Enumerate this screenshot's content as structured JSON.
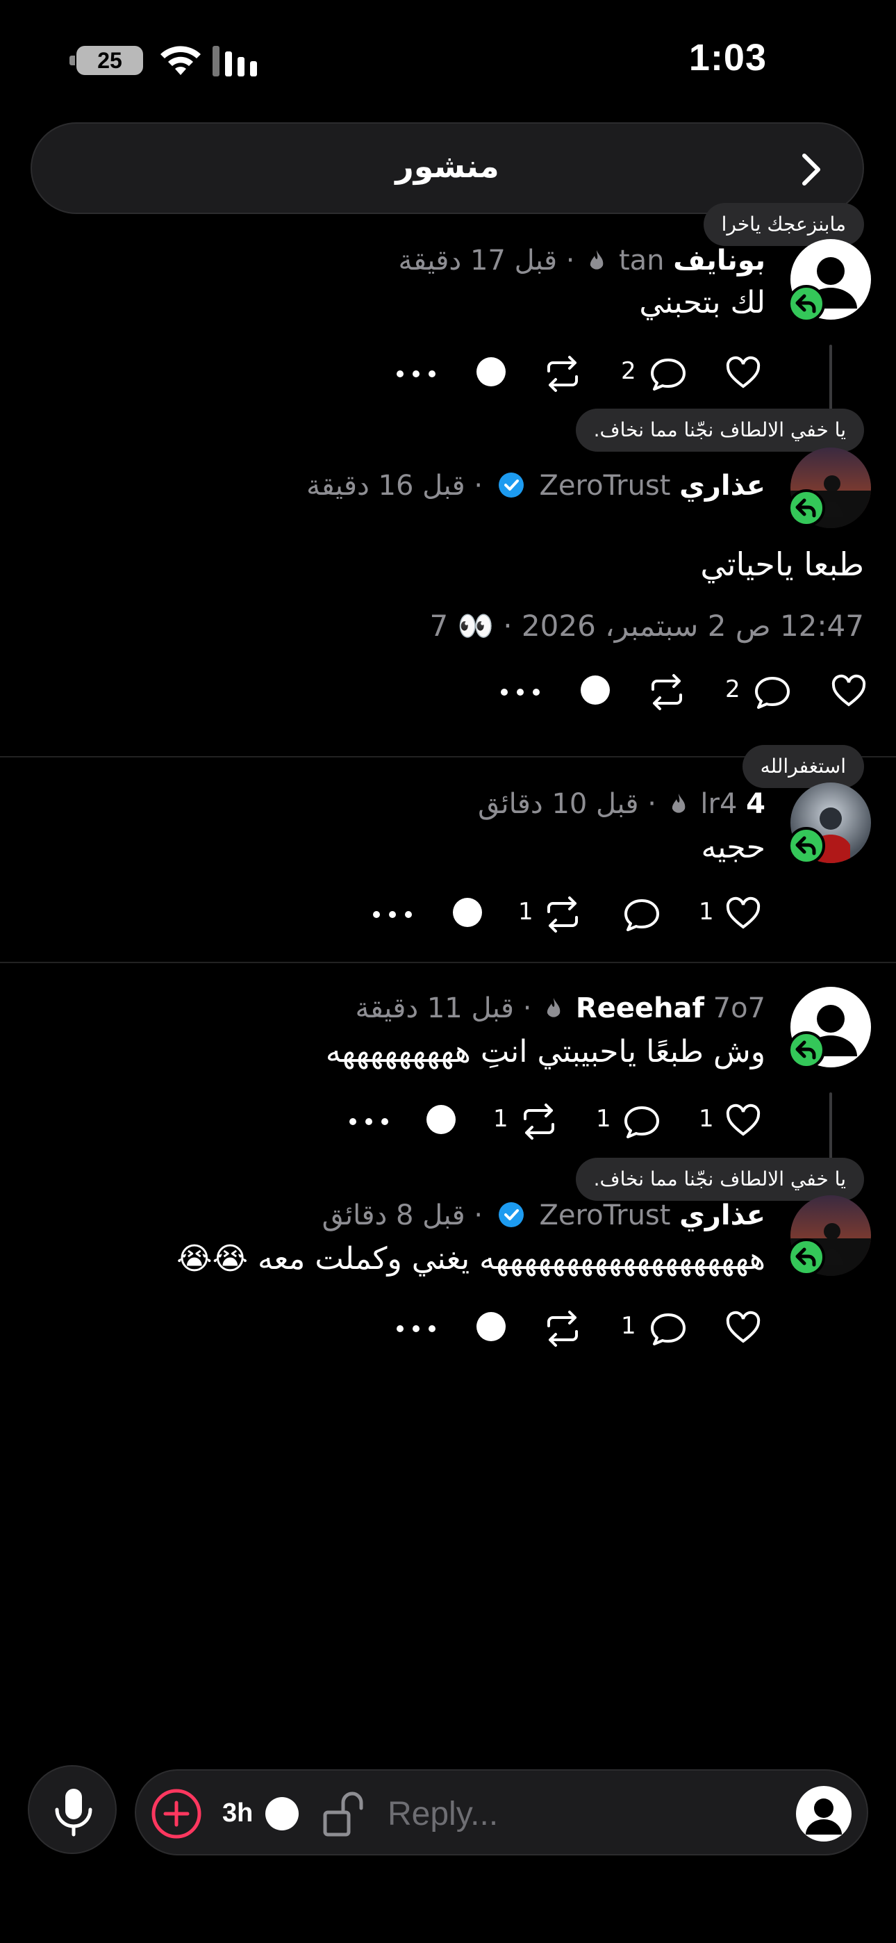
{
  "status_bar": {
    "time": "1:03",
    "battery": "25"
  },
  "header": {
    "title": "منشور"
  },
  "comments": [
    {
      "note": "مابنزعجك ياخرا",
      "name": "بونايف",
      "handle": "tan",
      "time_ago": "قبل 17 دقيقة",
      "text": "لك بتحبني",
      "reply_count": "2"
    },
    {
      "note": "يا خفي الالطاف نجّنا مما نخاف.",
      "name": "عذاري",
      "handle": "ZeroTrust",
      "time_ago": "قبل 16 دقيقة",
      "text": "طبعا ياحياتي",
      "date": "12:47 ص 2 سبتمبر، 2026",
      "views": "7",
      "reply_count": "2"
    },
    {
      "note": "استغفرالله",
      "name": "4",
      "handle": "lr4",
      "time_ago": "قبل 10 دقائق",
      "text": "حجيه",
      "like_count": "1",
      "repost_count": "1"
    },
    {
      "name": "Reeehaf",
      "handle": "7o7",
      "time_ago": "قبل 11 دقيقة",
      "text": "وش طبعًا ياحبيبتي انتِ هههههههههه",
      "like_count": "1",
      "reply_count": "1",
      "repost_count": "1"
    },
    {
      "note": "يا خفي الالطاف نجّنا مما نخاف.",
      "name": "عذاري",
      "handle": "ZeroTrust",
      "time_ago": "قبل 8 دقائق",
      "text": "هههههههههههههههههههه يغني وكملت معه 😭😭",
      "reply_count": "1"
    }
  ],
  "composer": {
    "placeholder": "Reply...",
    "timer": "3h"
  },
  "icons": {
    "verified_color": "#1d9bf0",
    "reply_badge_color": "#34c759",
    "plus_color": "#ff375f"
  }
}
